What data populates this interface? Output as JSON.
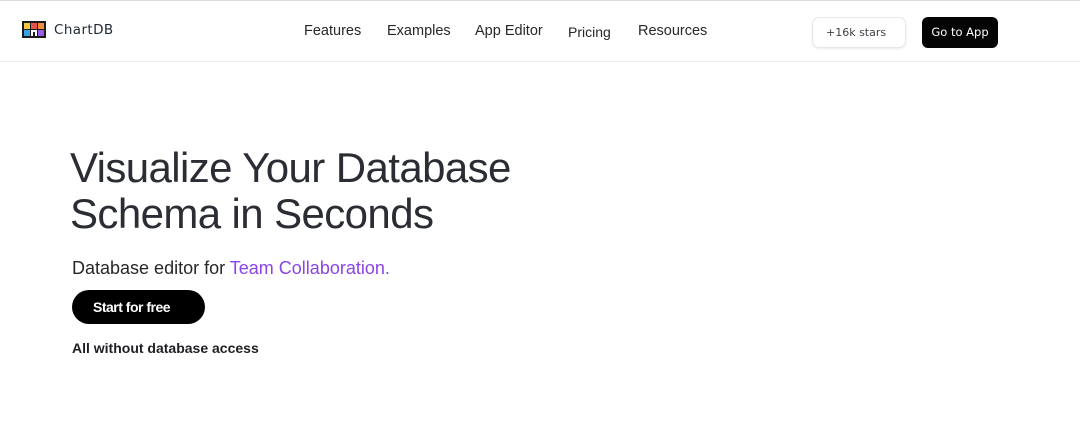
{
  "header": {
    "brand_name": "ChartDB",
    "logo_icon": "chartdb-logo-icon",
    "nav": [
      {
        "label": "Features"
      },
      {
        "label": "Examples"
      },
      {
        "label": "App Editor"
      },
      {
        "label": "Pricing"
      },
      {
        "label": "Resources"
      }
    ],
    "stars_label": "+16k stars",
    "cta_label": "Go to App"
  },
  "hero": {
    "title_line1": "Visualize Your Database",
    "title_line2": "Schema in Seconds",
    "subtitle_prefix": "Database editor for",
    "subtitle_highlight": "Team Collaboration.",
    "cta_label": "Start for free",
    "note": "All without database access"
  },
  "colors": {
    "accent": "#8a44e8",
    "button_bg": "#000000",
    "text": "#2a2d34"
  }
}
